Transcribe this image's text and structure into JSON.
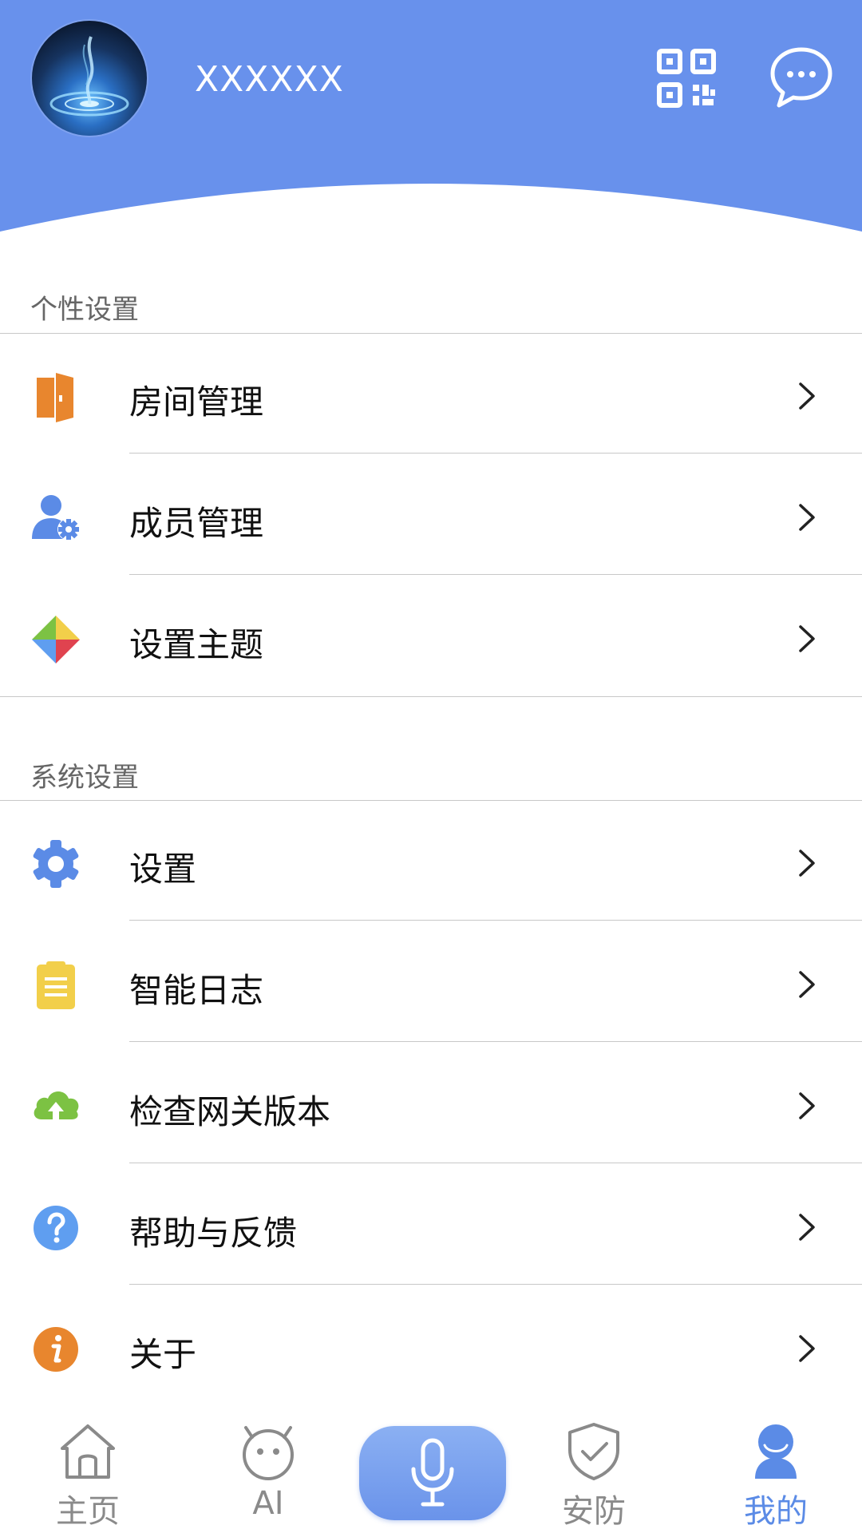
{
  "header": {
    "username": "XXXXXX",
    "bg_color": "#6891ec",
    "qr_icon": "qr-code-icon",
    "message_icon": "chat-bubble-icon"
  },
  "sections": [
    {
      "title": "个性设置",
      "items": [
        {
          "label": "房间管理",
          "icon": "door-icon",
          "color": "#e8862e"
        },
        {
          "label": "成员管理",
          "icon": "user-gear-icon",
          "color": "#5b8be6"
        },
        {
          "label": "设置主题",
          "icon": "pinwheel-icon",
          "color": "#7cc243"
        }
      ]
    },
    {
      "title": "系统设置",
      "items": [
        {
          "label": "设置",
          "icon": "gear-icon",
          "color": "#5b8be6"
        },
        {
          "label": "智能日志",
          "icon": "clipboard-icon",
          "color": "#f2cf4a"
        },
        {
          "label": "检查网关版本",
          "icon": "cloud-upload-icon",
          "color": "#7cc243"
        },
        {
          "label": "帮助与反馈",
          "icon": "help-icon",
          "color": "#5f9ef0"
        },
        {
          "label": "关于",
          "icon": "info-icon",
          "color": "#e8862e"
        }
      ]
    }
  ],
  "tabs": [
    {
      "label": "主页",
      "icon": "home-icon",
      "active": false
    },
    {
      "label": "AI",
      "icon": "robot-icon",
      "active": false
    },
    {
      "label": "安防",
      "icon": "shield-check-icon",
      "active": false
    },
    {
      "label": "我的",
      "icon": "person-icon",
      "active": true
    }
  ],
  "mic_button": {
    "icon": "microphone-icon"
  },
  "colors": {
    "accent": "#5b8be6",
    "inactive": "#8a8a8a"
  }
}
